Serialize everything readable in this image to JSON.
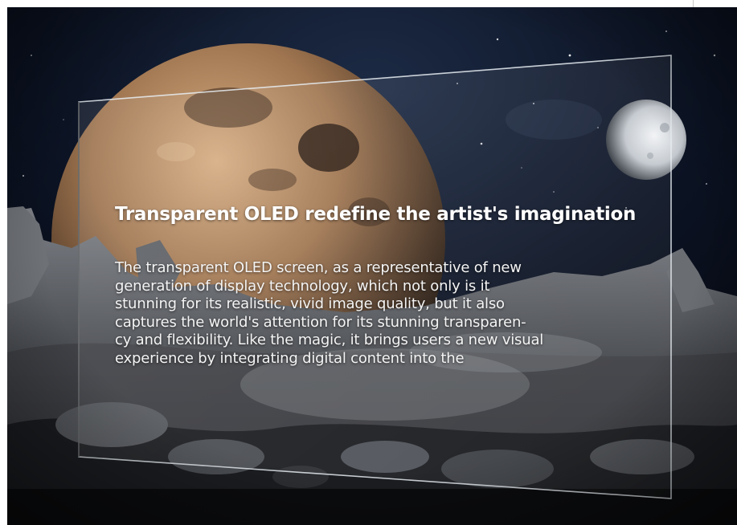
{
  "slide": {
    "headline": "Transparent OLED redefine the artist's imagination",
    "body_lines": [
      "The transparent OLED screen, as a representative of new",
      "generation of display technology, which not only is it",
      "stunning for its realistic, vivid image quality, but it also",
      "captures the world's attention for its stunning transparen-",
      "cy and flexibility. Like the magic, it brings users a new visual",
      "experience by integrating digital content into the"
    ]
  },
  "colors": {
    "sky": "#070b15",
    "planet": "#b48a63",
    "moon": "#d9dde2",
    "ground": "#5b5e63",
    "screen_edge": "#e8edf2",
    "text": "#ffffff"
  }
}
